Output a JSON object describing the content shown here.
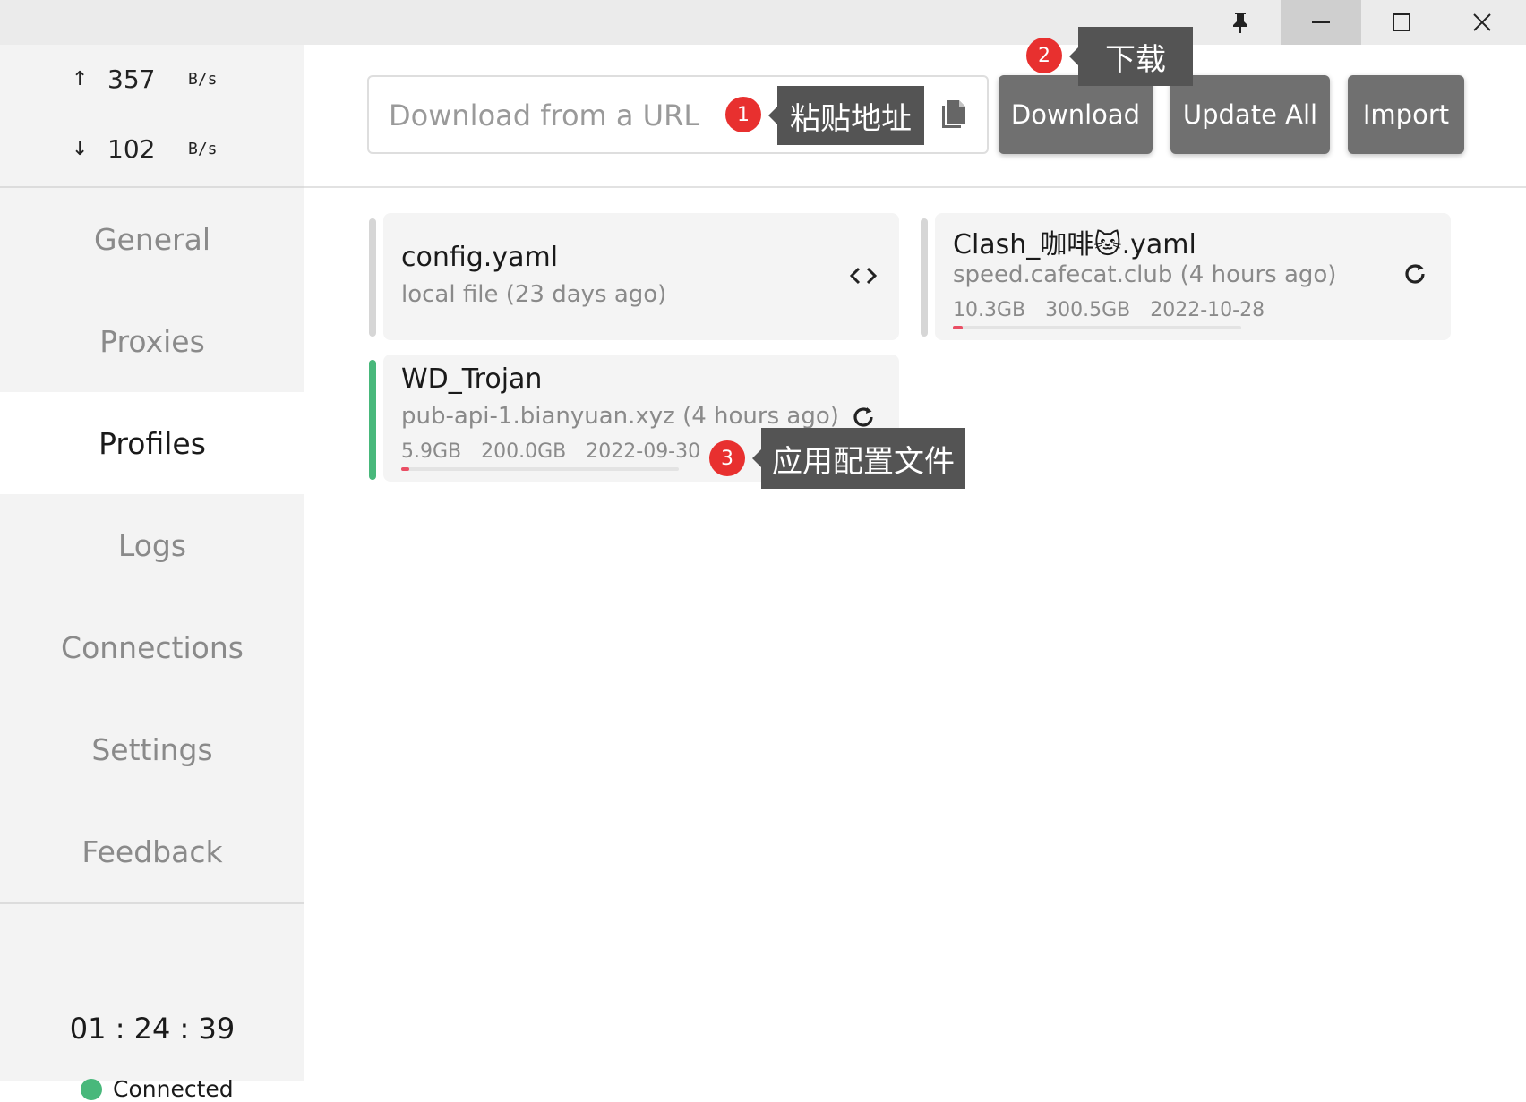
{
  "window": {
    "pin_icon": "pin-icon",
    "minimize_icon": "minimize-icon",
    "maximize_icon": "maximize-icon",
    "close_icon": "close-icon"
  },
  "traffic": {
    "up_arrow": "↑",
    "up_value": "357",
    "up_unit": "B/s",
    "down_arrow": "↓",
    "down_value": "102",
    "down_unit": "B/s"
  },
  "nav": {
    "items": [
      {
        "label": "General",
        "active": false
      },
      {
        "label": "Proxies",
        "active": false
      },
      {
        "label": "Profiles",
        "active": true
      },
      {
        "label": "Logs",
        "active": false
      },
      {
        "label": "Connections",
        "active": false
      },
      {
        "label": "Settings",
        "active": false
      },
      {
        "label": "Feedback",
        "active": false
      }
    ]
  },
  "footer": {
    "uptime": "01 : 24 : 39",
    "status": "Connected",
    "status_color": "#48b87b"
  },
  "toolbar": {
    "url_placeholder": "Download from a URL",
    "url_value": "",
    "paste_icon": "paste-icon",
    "download_label": "Download",
    "update_all_label": "Update All",
    "import_label": "Import"
  },
  "annotations": [
    {
      "number": "1",
      "text": "粘贴地址"
    },
    {
      "number": "2",
      "text": "下载"
    },
    {
      "number": "3",
      "text": "应用配置文件"
    }
  ],
  "profiles": [
    {
      "name": "config.yaml",
      "meta": "local file (23 days ago)",
      "action_icon": "code-icon",
      "selected": false
    },
    {
      "name": "Clash_咖啡🐱.yaml",
      "meta": "speed.cafecat.club (4 hours ago)",
      "used": "10.3GB",
      "total": "300.5GB",
      "expire": "2022-10-28",
      "usage_fraction": 0.034,
      "action_icon": "refresh-icon",
      "selected": false
    },
    {
      "name": "WD_Trojan",
      "meta": "pub-api-1.bianyuan.xyz (4 hours ago)",
      "used": "5.9GB",
      "total": "200.0GB",
      "expire": "2022-09-30",
      "usage_fraction": 0.03,
      "action_icon": "refresh-icon",
      "selected": true
    }
  ],
  "colors": {
    "accent_selected": "#48b87b",
    "usage_bar": "#ea4e64",
    "badge": "#e8302f",
    "tooltip": "#545454",
    "button": "#707070"
  }
}
